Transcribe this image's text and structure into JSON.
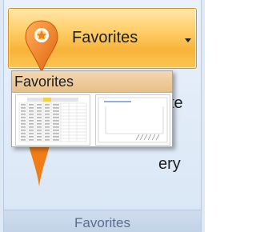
{
  "ribbon": {
    "favorites_button_label": "Favorites",
    "partial_text_1": "te",
    "partial_text_2": "ery",
    "group_label": "Favorites"
  },
  "gallery": {
    "title": "Favorites"
  },
  "colors": {
    "button_orange": "#f8b33a",
    "pin_orange": "#f07d16",
    "ribbon_bg": "#dfe9f5",
    "gallery_header": "#e8bf8a"
  },
  "icons": {
    "pin": "map-pin-icon",
    "dropdown": "chevron-down-icon"
  }
}
